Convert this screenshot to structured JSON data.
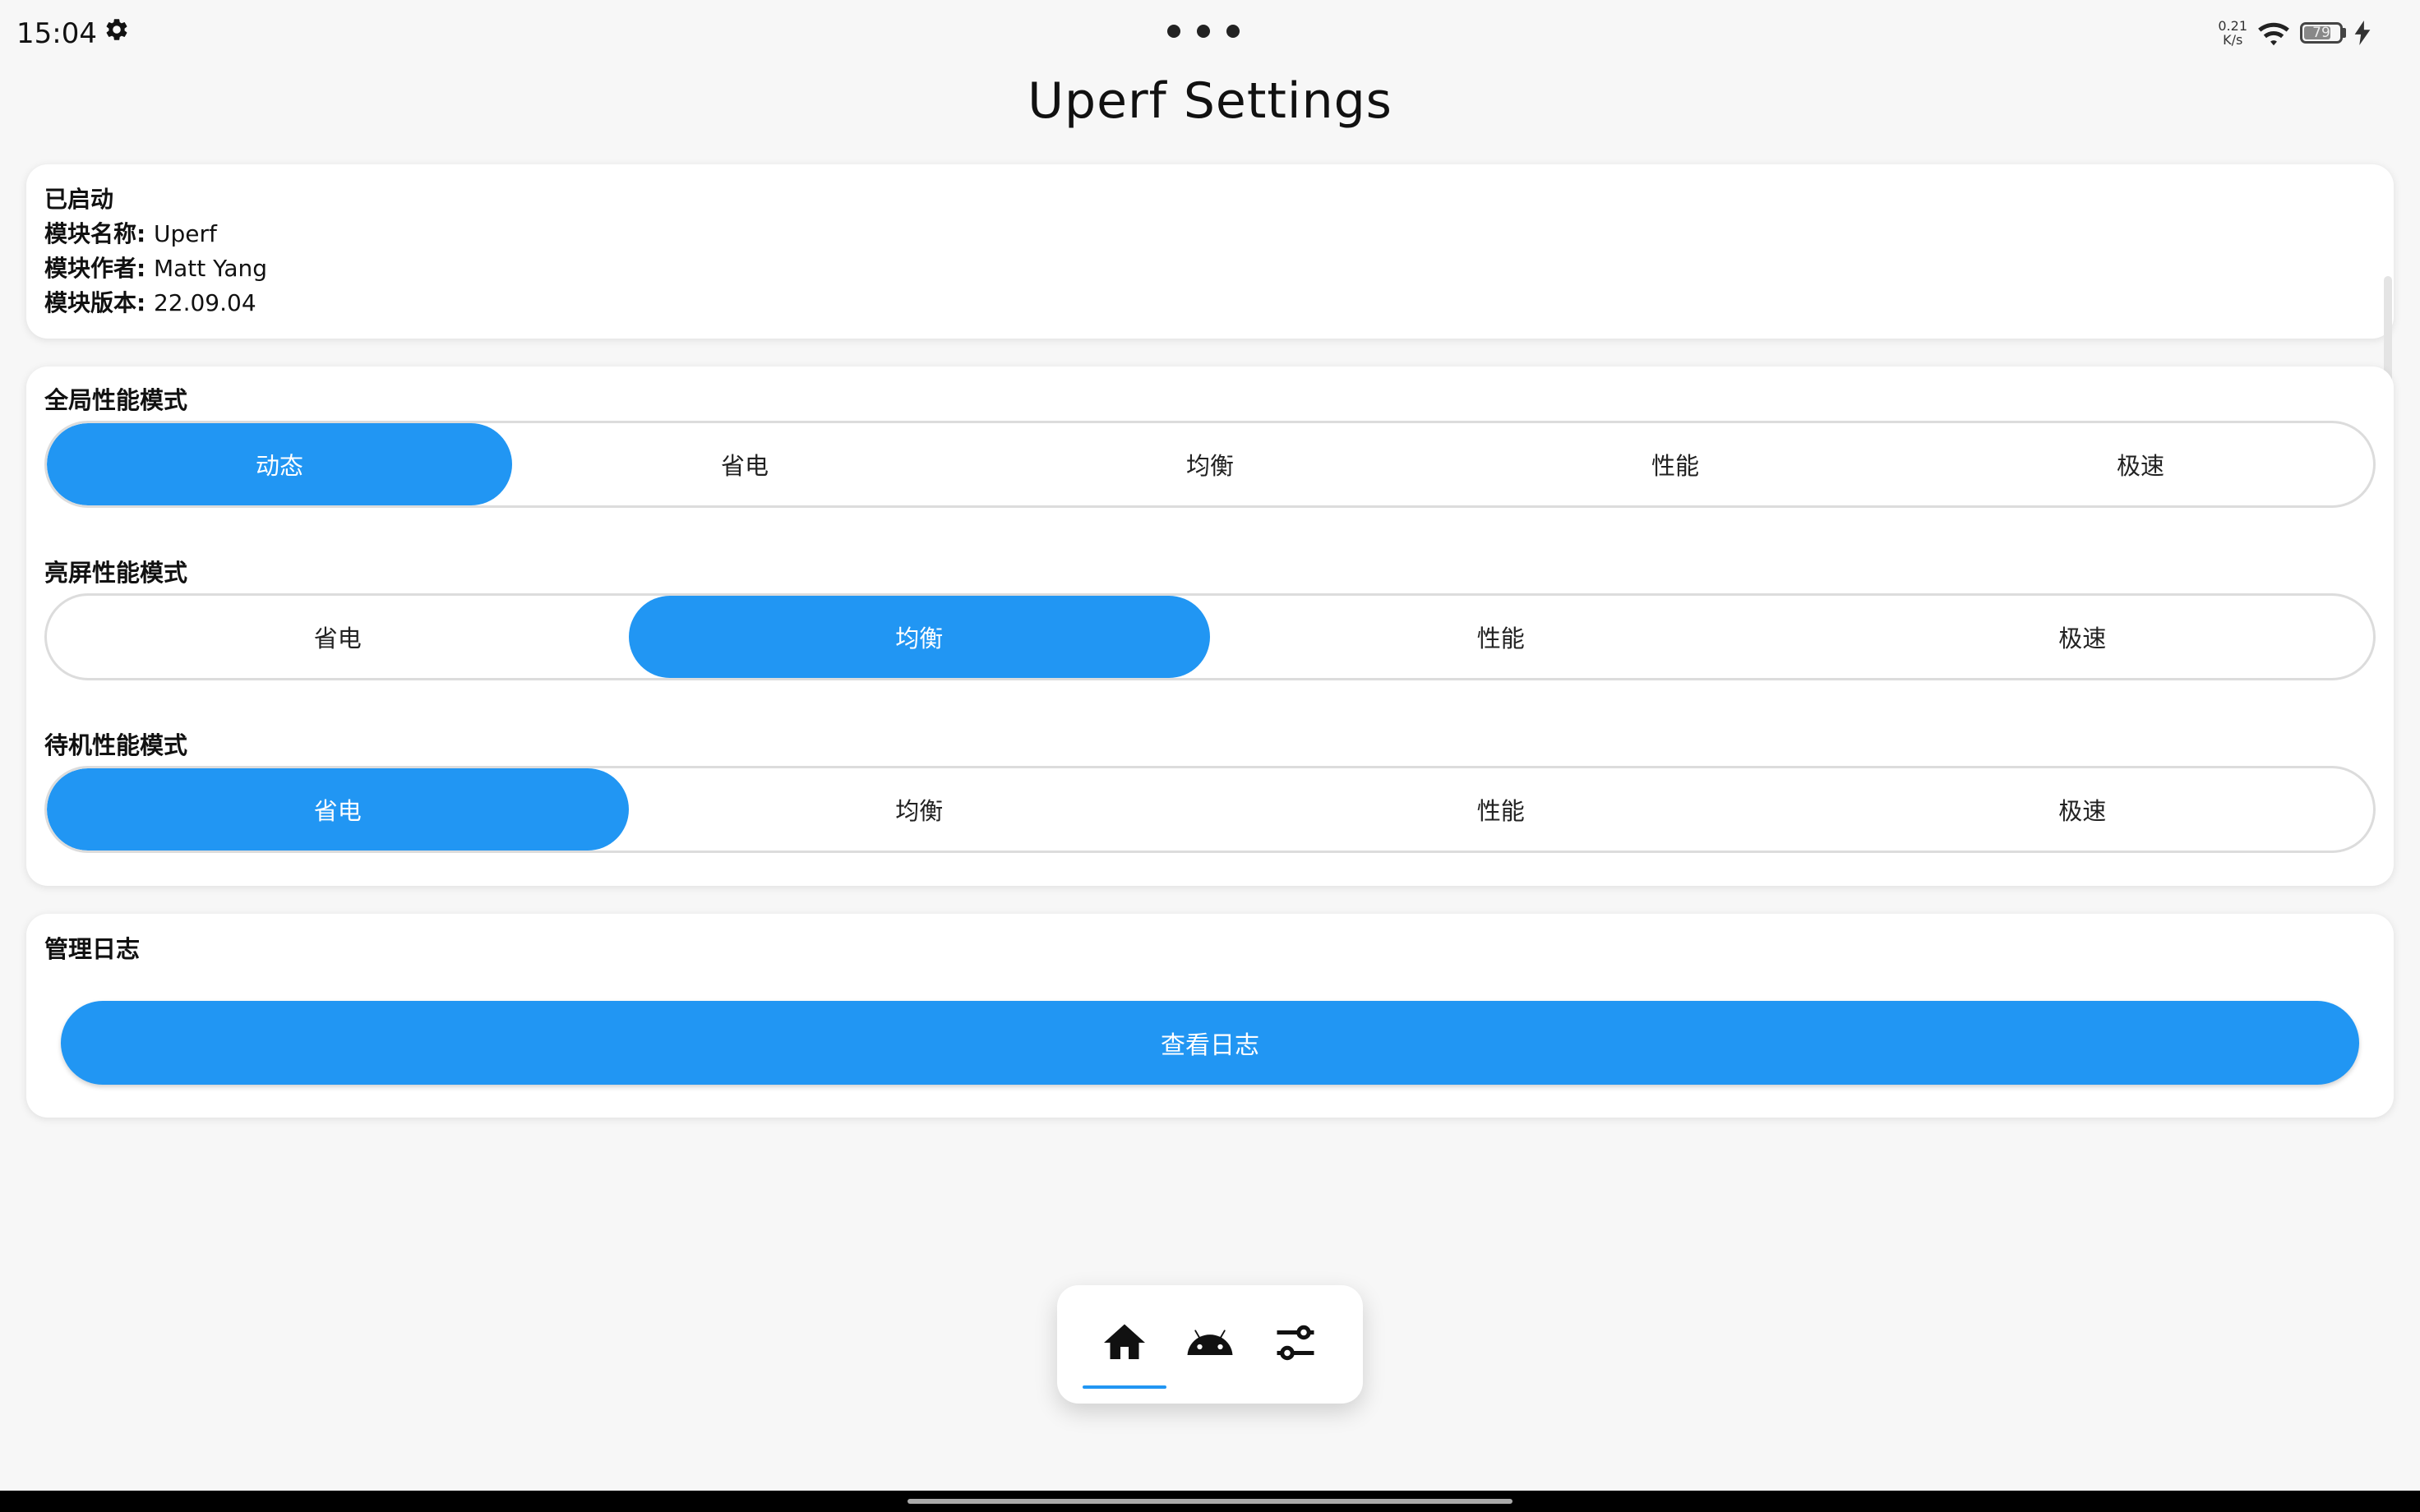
{
  "status_bar": {
    "time": "15:04",
    "net_speed_value": "0.21",
    "net_speed_unit": "K/s",
    "battery": "79",
    "battery_level": 0.79
  },
  "title": "Uperf Settings",
  "info": {
    "status": "已启动",
    "name_label": "模块名称: ",
    "name_value": "Uperf",
    "author_label": "模块作者: ",
    "author_value": "Matt Yang",
    "version_label": "模块版本: ",
    "version_value": "22.09.04"
  },
  "global_mode": {
    "title": "全局性能模式",
    "options": [
      "动态",
      "省电",
      "均衡",
      "性能",
      "极速"
    ],
    "selected": "动态"
  },
  "screen_on_mode": {
    "title": "亮屏性能模式",
    "options": [
      "省电",
      "均衡",
      "性能",
      "极速"
    ],
    "selected": "均衡"
  },
  "standby_mode": {
    "title": "待机性能模式",
    "options": [
      "省电",
      "均衡",
      "性能",
      "极速"
    ],
    "selected": "省电"
  },
  "log": {
    "title": "管理日志",
    "button": "查看日志"
  },
  "nav": {
    "items": [
      "home-icon",
      "android-icon",
      "tune-icon"
    ],
    "selected": "home-icon"
  },
  "colors": {
    "accent": "#2196f3",
    "background": "#f7f7f7",
    "card": "#ffffff"
  }
}
